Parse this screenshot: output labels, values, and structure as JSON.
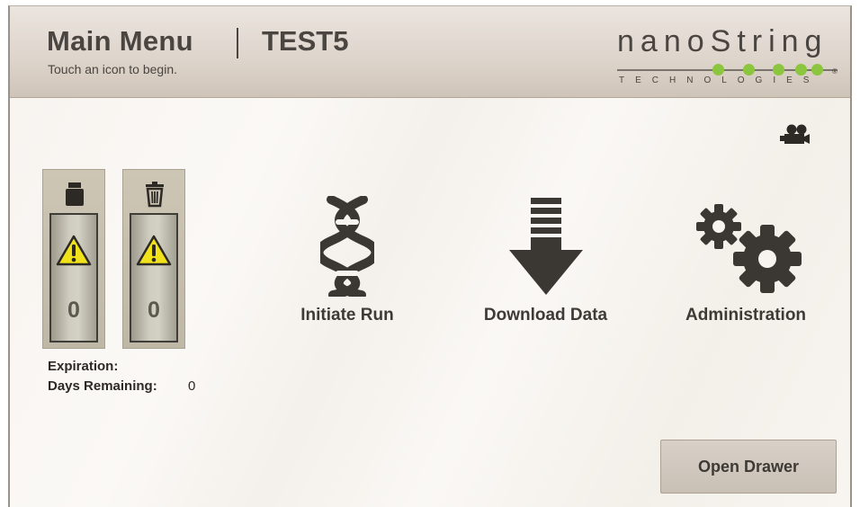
{
  "header": {
    "title": "Main Menu",
    "device_name": "TEST5",
    "subtitle": "Touch an icon to begin.",
    "logo_text": "nanoString",
    "logo_subtext": "TECHNOLOGIES",
    "logo_registered": "®"
  },
  "icons": {
    "video": "video-camera-icon",
    "cartridge": "cartridge-icon",
    "trash": "trash-icon",
    "warning": "warning-icon",
    "dna": "dna-icon",
    "download": "download-arrow-icon",
    "gears": "gears-icon"
  },
  "consumables": [
    {
      "name": "cartridge",
      "count": "0"
    },
    {
      "name": "waste",
      "count": "0"
    }
  ],
  "status": {
    "expiration_label": "Expiration:",
    "days_remaining_label": "Days Remaining:",
    "days_remaining_value": "0"
  },
  "menu": {
    "initiate_run": "Initiate Run",
    "download_data": "Download Data",
    "administration": "Administration"
  },
  "buttons": {
    "open_drawer": "Open Drawer"
  },
  "colors": {
    "text_dark": "#4a4540",
    "logo_green": "#8cc63f",
    "warning_yellow": "#f2e21b",
    "icon_dark": "#3b3733"
  }
}
